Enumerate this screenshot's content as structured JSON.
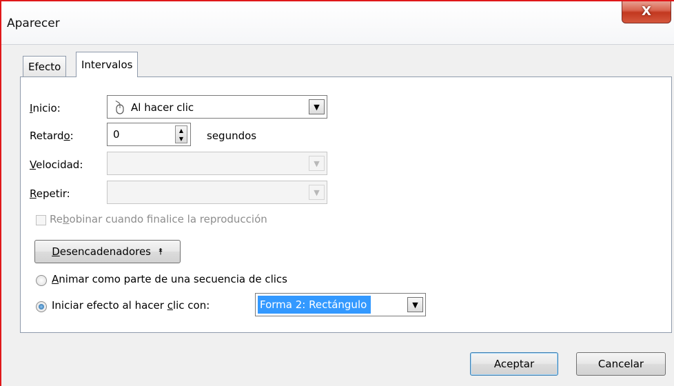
{
  "window": {
    "title": "Aparecer",
    "close_glyph": "X"
  },
  "tabs": [
    {
      "label": "Efecto",
      "selected": false
    },
    {
      "label": "Intervalos",
      "selected": true
    }
  ],
  "timing": {
    "inicio": {
      "label_pre": "",
      "label_u": "I",
      "label_post": "nicio:",
      "value": "Al hacer clic",
      "icon": "mouse-icon"
    },
    "retardo": {
      "label_pre": "Retard",
      "label_u": "o",
      "label_post": ":",
      "value": "0",
      "unit": "segundos"
    },
    "velocidad": {
      "label_pre": "",
      "label_u": "V",
      "label_post": "elocidad:",
      "value": ""
    },
    "repetir": {
      "label_pre": "",
      "label_u": "R",
      "label_post": "epetir:",
      "value": ""
    },
    "rebobinar": {
      "label_pre": "Re",
      "label_u": "b",
      "label_post": "obinar cuando finalice la reproducción",
      "checked": false,
      "enabled": false
    }
  },
  "triggers": {
    "button_label_pre": "",
    "button_label_u": "D",
    "button_label_post": "esencadenadores",
    "button_glyph": "⯭",
    "option_sequence": {
      "label_pre": "",
      "label_u": "A",
      "label_post": "nimar como parte de una secuencia de clics",
      "selected": false
    },
    "option_onclick": {
      "label_pre": "Iniciar efecto al hacer ",
      "label_u": "c",
      "label_post": "lic con:",
      "selected": true
    },
    "shape_value": "Forma 2: Rectángulo"
  },
  "footer": {
    "ok_label": "Aceptar",
    "cancel_label": "Cancelar"
  },
  "colors": {
    "frame_red": "#e0181a",
    "selection_blue": "#3399ff",
    "close_red": "#c2381f"
  }
}
